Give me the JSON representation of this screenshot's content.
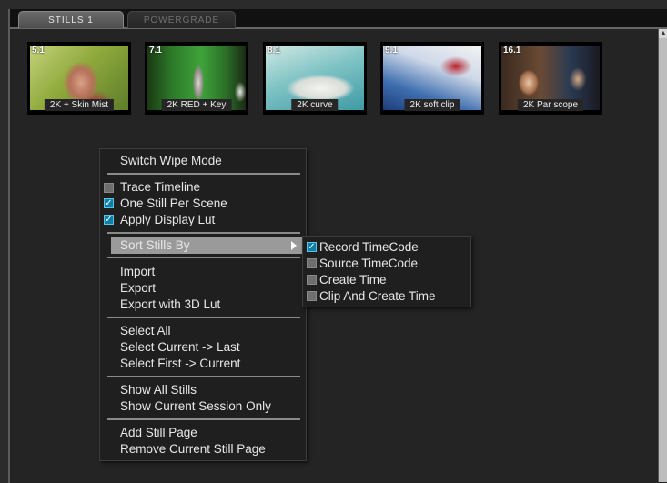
{
  "tabs": [
    {
      "label": "STILLS 1",
      "active": true
    },
    {
      "label": "POWERGRADE",
      "active": false
    }
  ],
  "stills": [
    {
      "number": "5.1",
      "label": "2K + Skin Mist"
    },
    {
      "number": "7.1",
      "label": "2K RED + Key"
    },
    {
      "number": "8.1",
      "label": "2K curve"
    },
    {
      "number": "9.1",
      "label": "2K soft clip"
    },
    {
      "number": "16.1",
      "label": "2K Par scope"
    }
  ],
  "context_menu": {
    "switch_wipe_mode": "Switch Wipe Mode",
    "trace_timeline": {
      "label": "Trace Timeline",
      "checked": false
    },
    "one_still_per_scene": {
      "label": "One Still Per Scene",
      "checked": true
    },
    "apply_display_lut": {
      "label": "Apply Display Lut",
      "checked": true
    },
    "sort_stills_by": "Sort Stills By",
    "import": "Import",
    "export": "Export",
    "export_3d_lut": "Export with 3D Lut",
    "select_all": "Select All",
    "select_current_last": "Select Current -> Last",
    "select_first_current": "Select First -> Current",
    "show_all_stills": "Show All Stills",
    "show_current_session": "Show Current Session Only",
    "add_still_page": "Add Still Page",
    "remove_still_page": "Remove Current Still Page"
  },
  "sort_submenu": [
    {
      "label": "Record TimeCode",
      "checked": true
    },
    {
      "label": "Source TimeCode",
      "checked": false
    },
    {
      "label": "Create Time",
      "checked": false
    },
    {
      "label": "Clip And Create Time",
      "checked": false
    }
  ],
  "colors": {
    "highlight": "#9a9a9a",
    "check_on": "#0f7fa8"
  }
}
